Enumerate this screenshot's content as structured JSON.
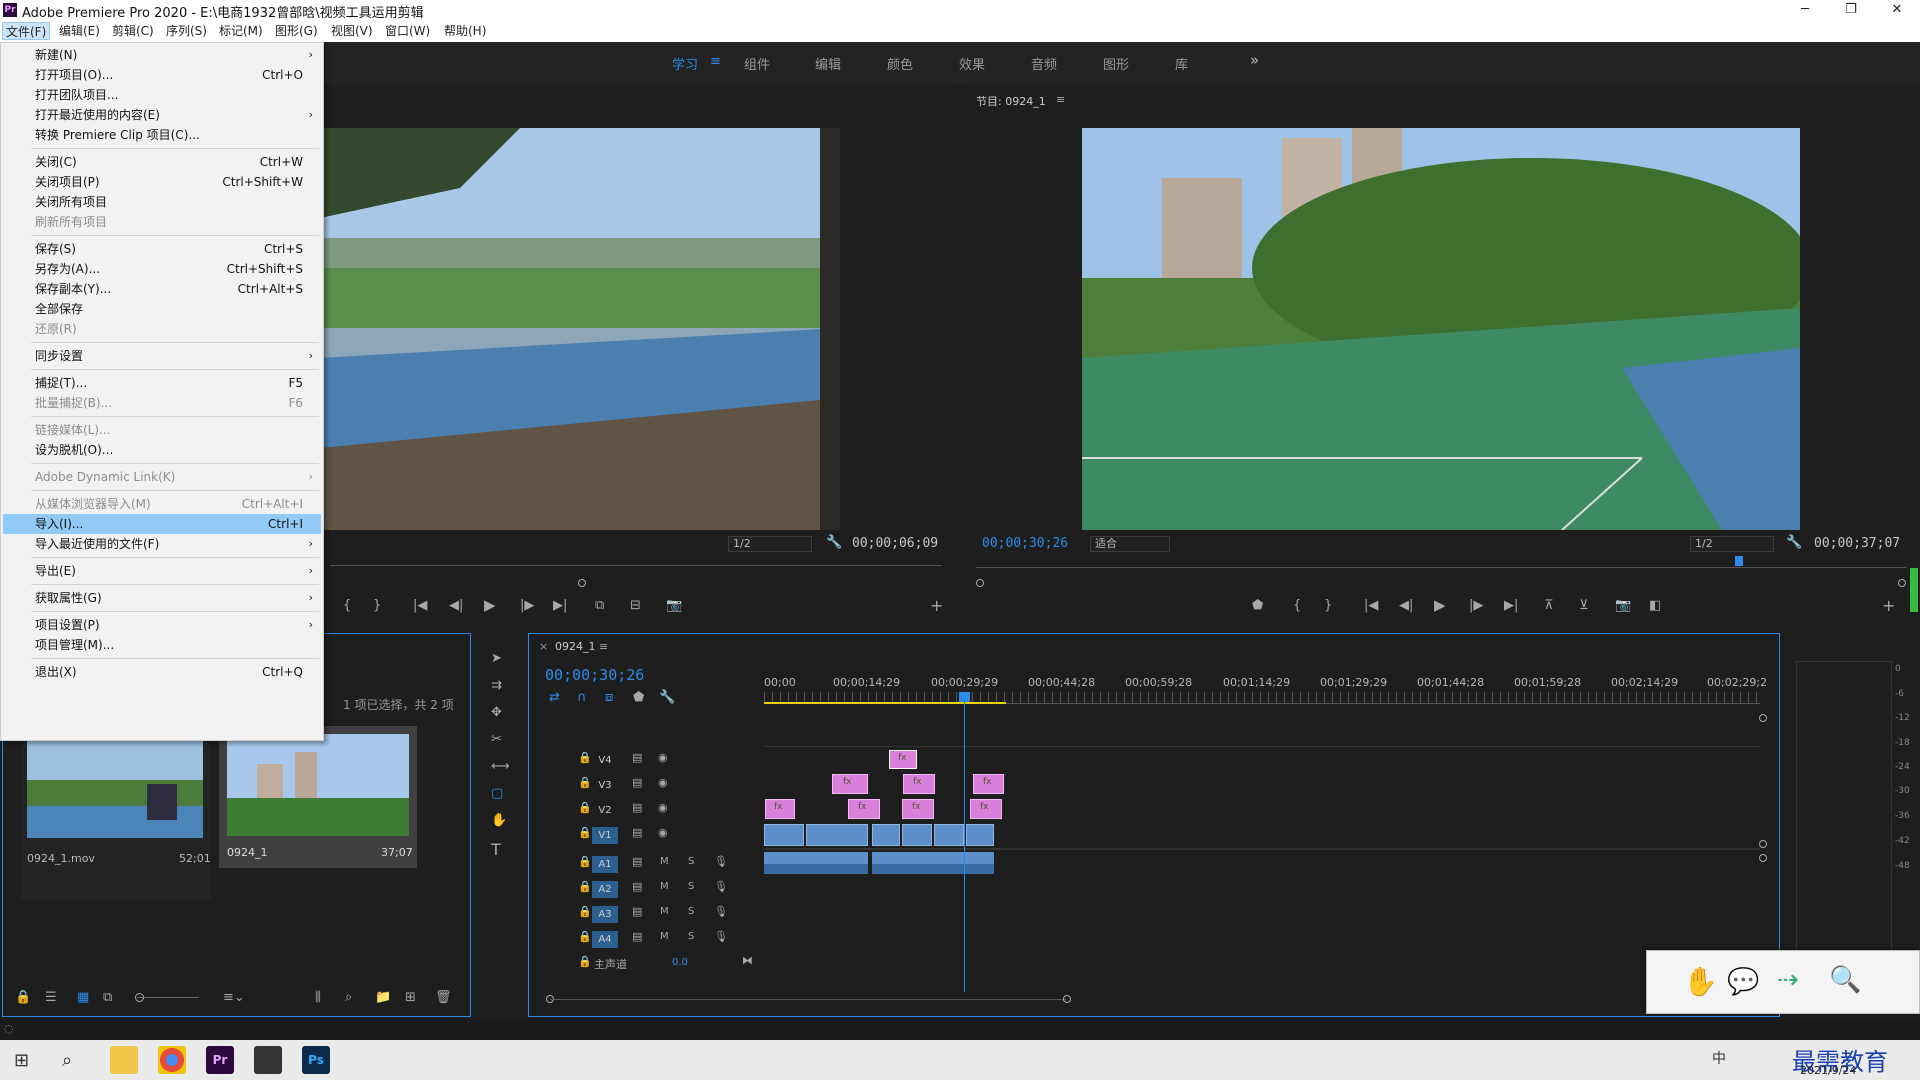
{
  "titlebar": {
    "app_title": "Adobe Premiere Pro 2020 - E:\\电商1932曾部晗\\视频工具运用剪辑",
    "minimize": "─",
    "maximize": "❐",
    "close": "✕"
  },
  "menubar": [
    "文件(F)",
    "编辑(E)",
    "剪辑(C)",
    "序列(S)",
    "标记(M)",
    "图形(G)",
    "视图(V)",
    "窗口(W)",
    "帮助(H)"
  ],
  "workspaces": [
    "学习",
    "组件",
    "编辑",
    "颜色",
    "效果",
    "音频",
    "图形",
    "库"
  ],
  "workspace_overflow": "»",
  "file_menu": [
    {
      "label": "新建(N)",
      "shortcut": "",
      "submenu": true,
      "disabled": false
    },
    {
      "label": "打开项目(O)...",
      "shortcut": "Ctrl+O",
      "submenu": false,
      "disabled": false
    },
    {
      "label": "打开团队项目...",
      "shortcut": "",
      "submenu": false,
      "disabled": false
    },
    {
      "label": "打开最近使用的内容(E)",
      "shortcut": "",
      "submenu": true,
      "disabled": false
    },
    {
      "label": "转换 Premiere Clip 项目(C)...",
      "shortcut": "",
      "submenu": false,
      "disabled": false
    },
    {
      "label": "关闭(C)",
      "shortcut": "Ctrl+W",
      "submenu": false,
      "disabled": false
    },
    {
      "label": "关闭项目(P)",
      "shortcut": "Ctrl+Shift+W",
      "submenu": false,
      "disabled": false
    },
    {
      "label": "关闭所有项目",
      "shortcut": "",
      "submenu": false,
      "disabled": false
    },
    {
      "label": "刷新所有项目",
      "shortcut": "",
      "submenu": false,
      "disabled": true
    },
    {
      "label": "保存(S)",
      "shortcut": "Ctrl+S",
      "submenu": false,
      "disabled": false
    },
    {
      "label": "另存为(A)...",
      "shortcut": "Ctrl+Shift+S",
      "submenu": false,
      "disabled": false
    },
    {
      "label": "保存副本(Y)...",
      "shortcut": "Ctrl+Alt+S",
      "submenu": false,
      "disabled": false
    },
    {
      "label": "全部保存",
      "shortcut": "",
      "submenu": false,
      "disabled": false
    },
    {
      "label": "还原(R)",
      "shortcut": "",
      "submenu": false,
      "disabled": true
    },
    {
      "label": "同步设置",
      "shortcut": "",
      "submenu": true,
      "disabled": false
    },
    {
      "label": "捕捉(T)...",
      "shortcut": "F5",
      "submenu": false,
      "disabled": false
    },
    {
      "label": "批量捕捉(B)...",
      "shortcut": "F6",
      "submenu": false,
      "disabled": true
    },
    {
      "label": "链接媒体(L)...",
      "shortcut": "",
      "submenu": false,
      "disabled": true
    },
    {
      "label": "设为脱机(O)...",
      "shortcut": "",
      "submenu": false,
      "disabled": false
    },
    {
      "label": "Adobe Dynamic Link(K)",
      "shortcut": "",
      "submenu": true,
      "disabled": true
    },
    {
      "label": "从媒体浏览器导入(M)",
      "shortcut": "Ctrl+Alt+I",
      "submenu": false,
      "disabled": true
    },
    {
      "label": "导入(I)...",
      "shortcut": "Ctrl+I",
      "submenu": false,
      "disabled": false,
      "highlight": true
    },
    {
      "label": "导入最近使用的文件(F)",
      "shortcut": "",
      "submenu": true,
      "disabled": false
    },
    {
      "label": "导出(E)",
      "shortcut": "",
      "submenu": true,
      "disabled": false
    },
    {
      "label": "获取属性(G)",
      "shortcut": "",
      "submenu": true,
      "disabled": false
    },
    {
      "label": "项目设置(P)",
      "shortcut": "",
      "submenu": true,
      "disabled": false
    },
    {
      "label": "项目管理(M)...",
      "shortcut": "",
      "submenu": false,
      "disabled": false
    },
    {
      "label": "退出(X)",
      "shortcut": "Ctrl+Q",
      "submenu": false,
      "disabled": false
    }
  ],
  "source": {
    "zoom": "1/2",
    "timecode": "00;00;06;09"
  },
  "program": {
    "title": "节目: 0924_1",
    "timecode_left": "00;00;30;26",
    "fit": "适合",
    "zoom": "1/2",
    "timecode_right": "00;00;37;07",
    "playhead_fraction": 0.82
  },
  "project": {
    "selection_info": "1 项已选择，共 2 项",
    "items": [
      {
        "name": "0924_1.mov",
        "duration": "52;01"
      },
      {
        "name": "0924_1",
        "duration": "37;07"
      }
    ]
  },
  "timeline": {
    "tab": "0924_1",
    "timecode": "00;00;30;26",
    "ruler": [
      "00;00",
      "00;00;14;29",
      "00;00;29;29",
      "00;00;44;28",
      "00;00;59;28",
      "00;01;14;29",
      "00;01;29;29",
      "00;01;44;28",
      "00;01;59;28",
      "00;02;14;29",
      "00;02;29;2"
    ],
    "video_tracks": [
      "V4",
      "V3",
      "V2",
      "V1"
    ],
    "audio_tracks": [
      "A1",
      "A2",
      "A3",
      "A4"
    ],
    "mute": "M",
    "solo": "S",
    "master_label": "主声道",
    "master_value": "0.0",
    "clip_fx": "fx"
  },
  "meters": {
    "scale": [
      "0",
      "-6",
      "-12",
      "-18",
      "-24",
      "-30",
      "-36",
      "-42",
      "-48"
    ]
  },
  "taskbar": {
    "date": "2021/9/24",
    "ime": "中",
    "watermark": "最需教育"
  },
  "colors": {
    "accent": "#2d8ceb",
    "clip_video": "#5d8fca",
    "clip_fx": "#d97fdc",
    "menu_highlight": "#91c9f7"
  }
}
